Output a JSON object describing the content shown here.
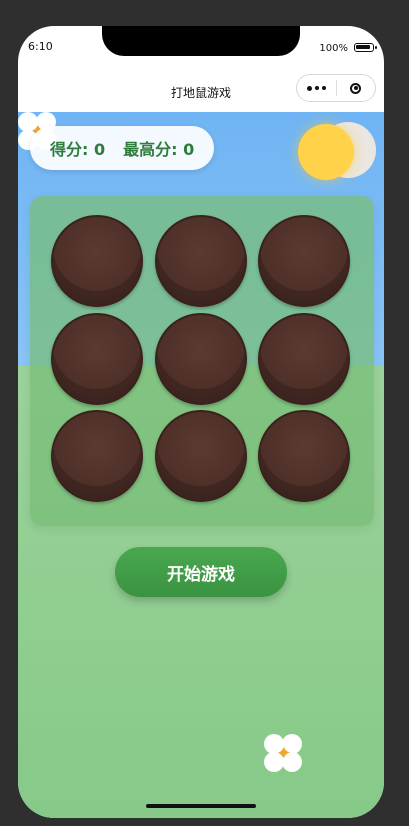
{
  "status_bar": {
    "time": "6:10",
    "battery_percent": "100%"
  },
  "navbar": {
    "title": "打地鼠游戏",
    "more_icon": "ellipsis-icon",
    "close_icon": "target-circle-icon"
  },
  "score_panel": {
    "score_text": "得分: 0",
    "best_text": "最高分: 0"
  },
  "game": {
    "grid_rows": 3,
    "grid_cols": 3,
    "hole_count": 9,
    "start_button_label": "开始游戏"
  },
  "colors": {
    "sky": "#6fb4f4",
    "grass": "#8fcd90",
    "score_text": "#2f7d3a",
    "button": "#3f9a46",
    "hole": "#4d2f28",
    "sun": "#ffd24a"
  }
}
